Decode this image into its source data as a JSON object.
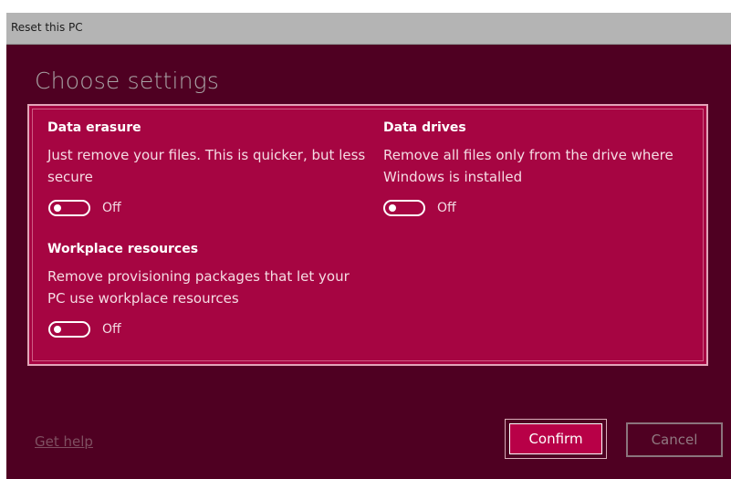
{
  "window": {
    "title": "Reset this PC",
    "background": "#4f0022",
    "accent": "#a60542"
  },
  "heading": "Choose settings",
  "settings": [
    {
      "title": "Data erasure",
      "description": "Just remove your files. This is quicker, but less secure",
      "state": "Off"
    },
    {
      "title": "Data drives",
      "description": "Remove all files only from the drive where Windows is installed",
      "state": "Off"
    },
    {
      "title": "Workplace resources",
      "description": "Remove provisioning packages that let your PC use workplace resources",
      "state": "Off"
    }
  ],
  "footer": {
    "help_label": "Get help",
    "confirm_label": "Confirm",
    "cancel_label": "Cancel"
  }
}
